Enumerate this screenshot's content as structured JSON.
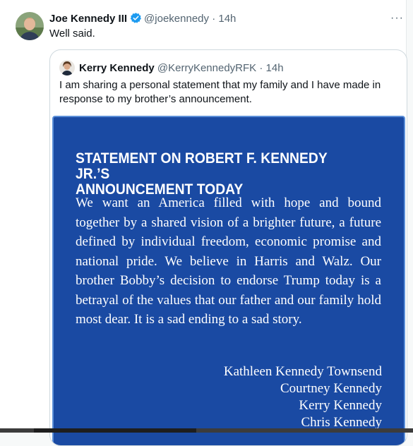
{
  "tweet": {
    "author_name": "Joe Kennedy III",
    "handle": "@joekennedy",
    "separator": "·",
    "time": "14h",
    "text": "Well said.",
    "more_label": "···"
  },
  "quoted": {
    "author_name": "Kerry Kennedy",
    "handle": "@KerryKennedyRFK",
    "separator": "·",
    "time": "14h",
    "text": "I am sharing a personal statement that my family and I have made in response to my brother’s announcement."
  },
  "statement": {
    "title_line1": "STATEMENT ON ROBERT F. KENNEDY JR.’S",
    "title_line2": "ANNOUNCEMENT TODAY",
    "body": "We want an America filled with hope and bound together by a shared vision of a brighter future, a future defined by individual freedom, economic promise and national pride. We believe in Harris and Walz. Our brother Bobby’s decision to endorse Trump today is a betrayal of the values that our father and our family hold most dear. It is a sad ending to a sad story.",
    "signatures": [
      "Kathleen Kennedy Townsend",
      "Courtney Kennedy",
      "Kerry Kennedy",
      "Chris Kennedy"
    ]
  },
  "colors": {
    "statement_background": "#1a4aa3",
    "verified_badge": "#1d9bf0",
    "secondary_text": "#536471"
  }
}
